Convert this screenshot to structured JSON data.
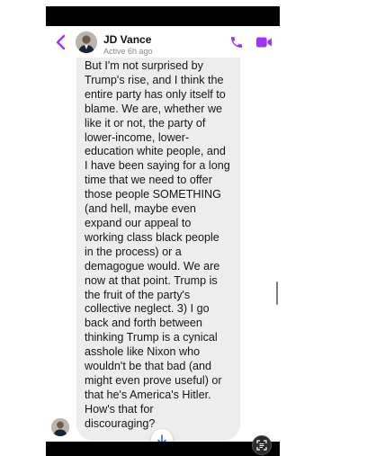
{
  "header": {
    "contact_name": "JD Vance",
    "status": "Active 6h ago",
    "icons": {
      "back": "chevron-left-icon",
      "call": "phone-icon",
      "video": "video-camera-icon"
    },
    "accent_color": "#a033ff"
  },
  "message": {
    "lines": [
      "But I'm not surprised by",
      "Trump's rise, and I think the",
      "entire party has only itself to",
      "blame.  We are, whether we",
      "like it or not, the party of",
      "lower-income, lower-",
      "education white people, and",
      "I have been saying for a long",
      "time that we need to offer",
      "those people SOMETHING",
      "(and hell, maybe even",
      "expand our appeal to",
      "working class black people",
      "in the process) or a",
      "demagogue would.  We are",
      "now at that point.  Trump is",
      "the fruit of the party's",
      "collective neglect.  3) I go",
      "back and forth between",
      "thinking Trump is a cynical",
      "asshole like Nixon who",
      "wouldn't be that bad (and",
      "might even prove useful) or",
      "that he's America's Hitler.",
      "How's that for",
      "discouraging?"
    ],
    "bubble_color": "#ededed"
  },
  "controls": {
    "scroll_down_icon": "arrow-down-icon",
    "scan_icon": "text-scan-icon"
  }
}
